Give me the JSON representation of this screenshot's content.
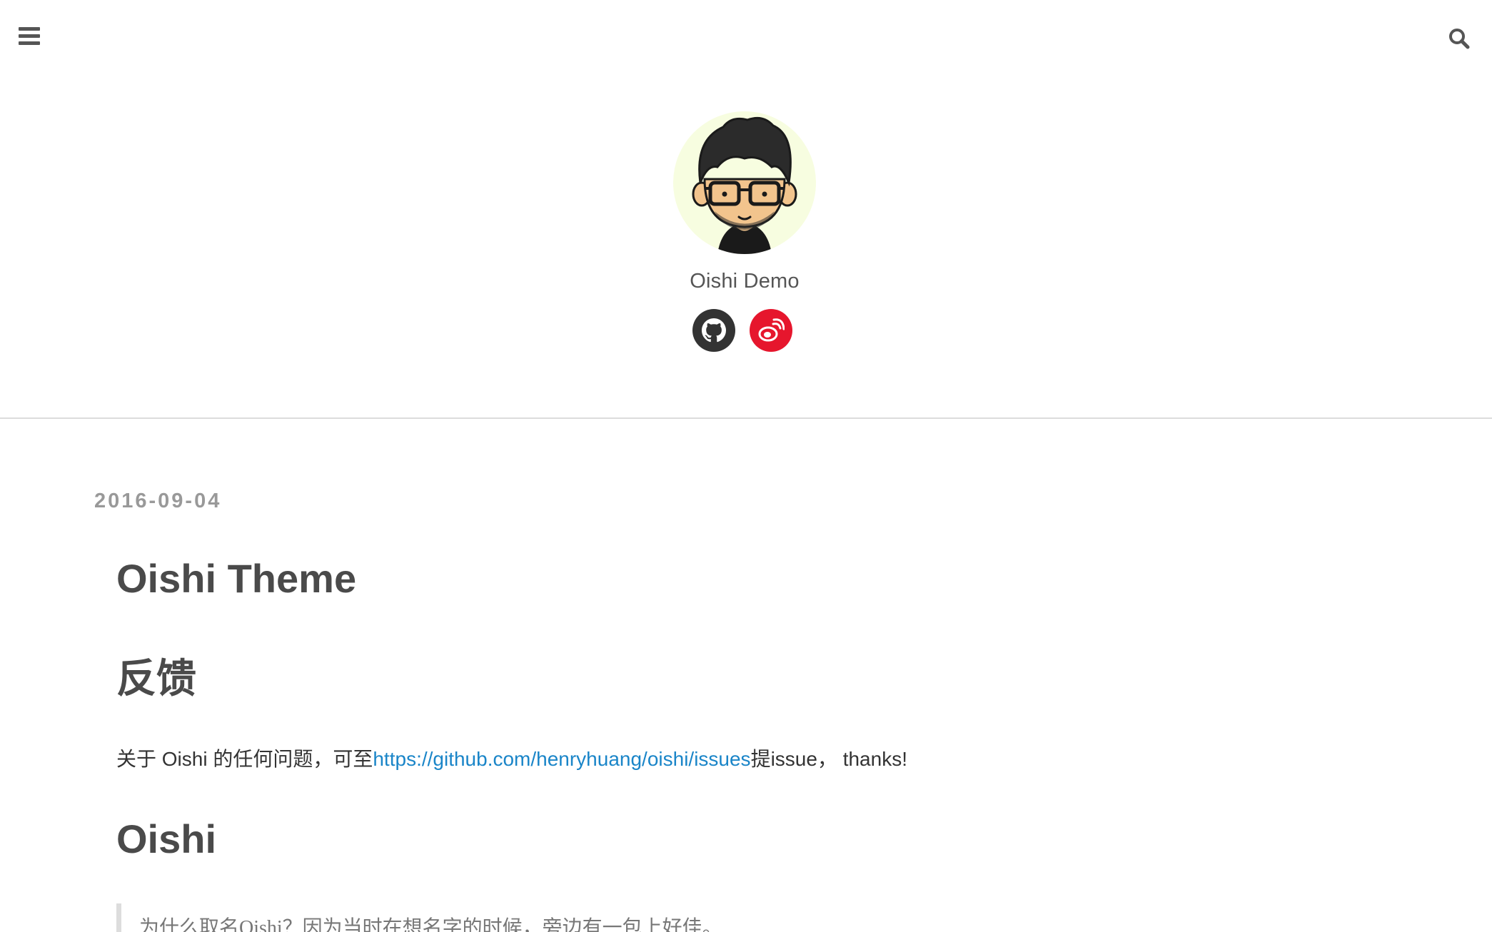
{
  "topbar": {
    "menu_icon": "menu-icon",
    "search_icon": "search-icon"
  },
  "header": {
    "site_name": "Oishi Demo",
    "avatar_alt": "avatar",
    "social": [
      {
        "name": "github",
        "icon": "github-icon",
        "color": "#333333"
      },
      {
        "name": "weibo",
        "icon": "weibo-icon",
        "color": "#e6162d"
      }
    ]
  },
  "post": {
    "date": "2016-09-04",
    "title": "Oishi Theme",
    "sections": {
      "feedback_heading": "反馈",
      "feedback_prefix": "关于 Oishi 的任何问题，可至",
      "feedback_link": "https://github.com/henryhuang/oishi/issues",
      "feedback_suffix": "提issue， thanks!",
      "oishi_heading": "Oishi",
      "quote": "为什么取名Oishi？因为当时在想名字的时候，旁边有一包上好佳。"
    }
  },
  "colors": {
    "link": "#1a85c8",
    "text": "#4a4a4a",
    "date": "#999999"
  }
}
